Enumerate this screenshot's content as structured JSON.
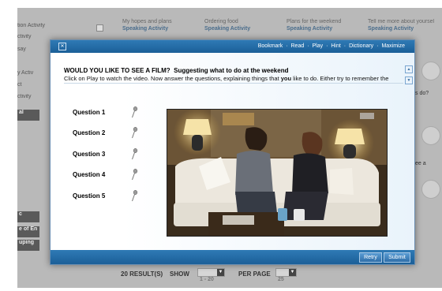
{
  "background": {
    "left_items": [
      "tion Activity",
      "ctivity",
      "say",
      "y Activ",
      "ct",
      "ctivity"
    ],
    "left_dark_items": [
      "al",
      "c",
      "e of En",
      "uping"
    ],
    "top_cards": [
      {
        "title": "My hopes and plans",
        "type": "Speaking Activity"
      },
      {
        "title": "Ordering food",
        "type": "Speaking Activity"
      },
      {
        "title": "Plans for the weekend",
        "type": "Speaking Activity"
      },
      {
        "title": "Tell me more about yoursel",
        "type": "Speaking Activity"
      }
    ],
    "side_texts": [
      "s do?",
      "ee a"
    ],
    "bottom": {
      "results": "20 RESULT(S)",
      "show_label": "SHOW",
      "show_value": "1 - 20",
      "per_page_label": "PER PAGE",
      "per_page_value": "25"
    }
  },
  "modal": {
    "close_glyph": "✕",
    "menu": [
      "Bookmark",
      "Read",
      "Play",
      "Hint",
      "Dictionary",
      "Maximize"
    ],
    "menu_separator": "·",
    "title": "WOULD YOU LIKE TO SEE A FILM?",
    "subtitle": "Suggesting what to do at the weekend",
    "instruction_pre": "Click on Play to watch the video. Now answer the questions, explaining things that ",
    "instruction_bold": "you",
    "instruction_post": " like to do. Either try to remember the",
    "questions": [
      "Question 1",
      "Question 2",
      "Question 3",
      "Question 4",
      "Question 5"
    ],
    "buttons": {
      "retry": "Retry",
      "submit": "Submit"
    }
  },
  "colors": {
    "header": "#1f65a0",
    "accent": "#4a6d8c"
  }
}
